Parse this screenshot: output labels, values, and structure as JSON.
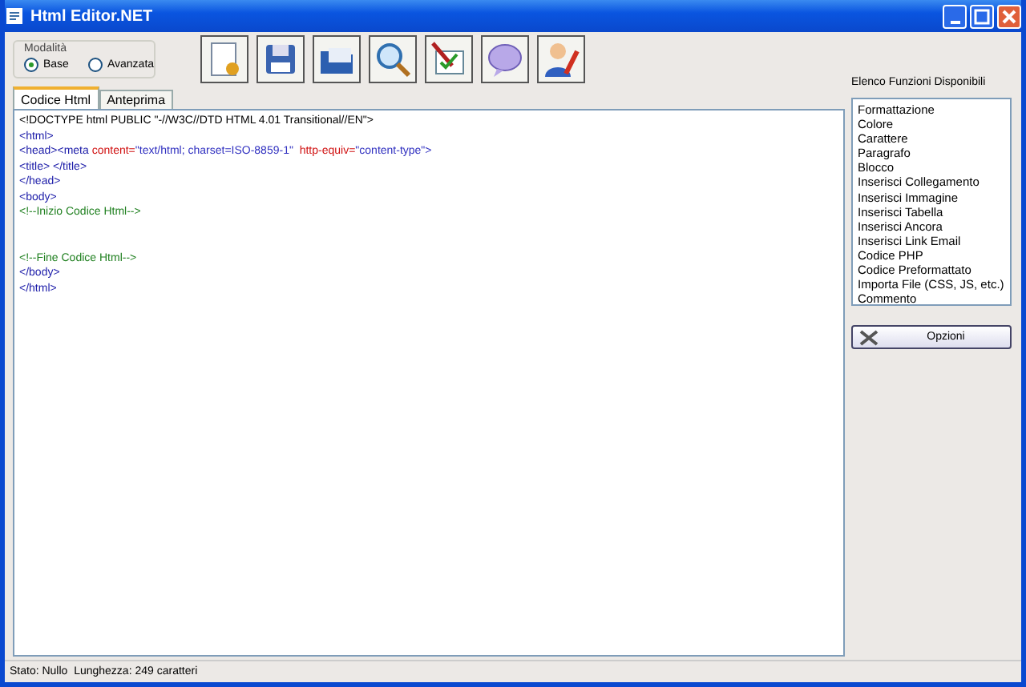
{
  "window": {
    "title": "Html Editor.NET"
  },
  "mode": {
    "legend": "Modalità",
    "options": [
      {
        "label": "Base",
        "selected": true
      },
      {
        "label": "Avanzata",
        "selected": false
      }
    ]
  },
  "tabs": [
    {
      "label": "Codice Html",
      "selected": true
    },
    {
      "label": "Anteprima",
      "selected": false
    }
  ],
  "code_lines": [
    {
      "kind": "code",
      "segments": [
        {
          "text": "<!DOCTYPE html PUBLIC \"-//W3C//DTD HTML 4.01 Transitional//EN\">",
          "kind": "text"
        }
      ]
    },
    {
      "kind": "code",
      "segments": [
        {
          "text": "<html>",
          "kind": "tag"
        }
      ]
    },
    {
      "kind": "code",
      "segments": [
        {
          "text": "<head><meta ",
          "kind": "tag"
        },
        {
          "text": "content=",
          "kind": "attr"
        },
        {
          "text": "\"text/html; charset=ISO-8859-1\"",
          "kind": "value"
        },
        {
          "text": "  http-equiv=",
          "kind": "attr"
        },
        {
          "text": "\"content-type\">",
          "kind": "value"
        }
      ]
    },
    {
      "kind": "code",
      "segments": [
        {
          "text": "<title> </title>",
          "kind": "tag"
        }
      ]
    },
    {
      "kind": "code",
      "segments": [
        {
          "text": "</head>",
          "kind": "tag"
        }
      ]
    },
    {
      "kind": "code",
      "segments": [
        {
          "text": "<body>",
          "kind": "tag"
        }
      ]
    },
    {
      "kind": "code",
      "segments": [
        {
          "text": "<!--Inizio Codice Html-->",
          "kind": "comment"
        }
      ]
    },
    {
      "kind": "blank"
    },
    {
      "kind": "blank"
    },
    {
      "kind": "code",
      "segments": [
        {
          "text": "<!--Fine Codice Html-->",
          "kind": "comment"
        }
      ]
    },
    {
      "kind": "code",
      "segments": [
        {
          "text": "</body>",
          "kind": "tag"
        }
      ]
    },
    {
      "kind": "code",
      "segments": [
        {
          "text": "</html>",
          "kind": "tag"
        }
      ]
    }
  ],
  "functions": {
    "title": "Elenco Funzioni Disponibili",
    "items": [
      "Formattazione",
      "Colore",
      "Carattere",
      "Paragrafo",
      "Blocco",
      "Inserisci Collegamento",
      "Inserisci Immagine",
      "Inserisci Tabella",
      "Inserisci Ancora",
      "Inserisci Link Email",
      "Codice PHP",
      "Codice Preformattato",
      "Importa File (CSS, JS, etc.)",
      "Commento"
    ],
    "button": "Opzioni"
  },
  "status_bar": "Stato: Nullo  Lunghezza: 249 caratteri"
}
